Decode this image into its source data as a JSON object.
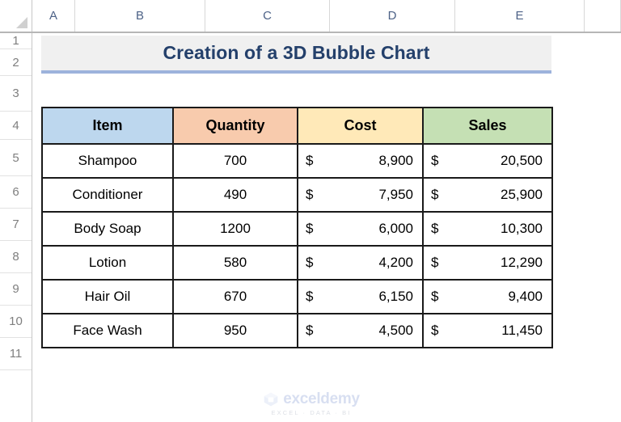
{
  "grid": {
    "column_headers": [
      "A",
      "B",
      "C",
      "D",
      "E"
    ],
    "row_headers": [
      "1",
      "2",
      "3",
      "4",
      "5",
      "6",
      "7",
      "8",
      "9",
      "10",
      "11"
    ],
    "select_all_icon": "select-all-triangle-icon"
  },
  "title": {
    "text": "Creation of a 3D Bubble Chart",
    "text_color": "#24406b",
    "fill_color": "#f0f0f0",
    "underline_color": "#9db3dc"
  },
  "table": {
    "headers": [
      "Item",
      "Quantity",
      "Cost",
      "Sales"
    ],
    "header_colors": [
      "#bdd7ee",
      "#f8cbad",
      "#ffe9b8",
      "#c5e0b4"
    ],
    "currency_symbol": "$",
    "rows": [
      {
        "item": "Shampoo",
        "quantity": "700",
        "cost": "8,900",
        "sales": "20,500"
      },
      {
        "item": "Conditioner",
        "quantity": "490",
        "cost": "7,950",
        "sales": "25,900"
      },
      {
        "item": "Body Soap",
        "quantity": "1200",
        "cost": "6,000",
        "sales": "10,300"
      },
      {
        "item": "Lotion",
        "quantity": "580",
        "cost": "4,200",
        "sales": "12,290"
      },
      {
        "item": "Hair Oil",
        "quantity": "670",
        "cost": "6,150",
        "sales": "9,400"
      },
      {
        "item": "Face Wash",
        "quantity": "950",
        "cost": "4,500",
        "sales": "11,450"
      }
    ]
  },
  "watermark": {
    "name": "exceldemy",
    "tagline": "EXCEL · DATA · BI",
    "color": "#8fa4d8"
  }
}
